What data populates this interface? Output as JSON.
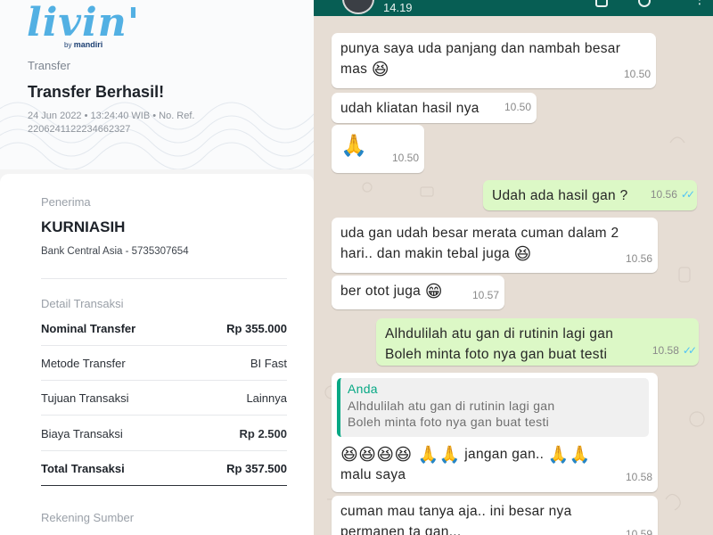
{
  "receipt": {
    "logo_text": "livin'",
    "logo_sub_prefix": "by",
    "logo_sub_brand": "mandiri",
    "breadcrumb": "Transfer",
    "title": "Transfer Berhasil!",
    "meta_line1": "24 Jun 2022 • 13:24:40 WIB • No. Ref.",
    "meta_line2": "2206241122234662327",
    "recipient_label": "Penerima",
    "recipient_name": "KURNIASIH",
    "recipient_bank": "Bank Central Asia - 5735307654",
    "detail_label": "Detail Transaksi",
    "rows": [
      {
        "label": "Nominal Transfer",
        "value": "Rp 355.000"
      },
      {
        "label": "Metode Transfer",
        "value": "BI Fast"
      },
      {
        "label": "Tujuan Transaksi",
        "value": "Lainnya"
      },
      {
        "label": "Biaya Transaksi",
        "value": "Rp 2.500"
      },
      {
        "label": "Total Transaksi",
        "value": "Rp 357.500"
      }
    ],
    "source_label": "Rekening Sumber"
  },
  "chat": {
    "header_time": "14.19",
    "messages": [
      {
        "dir": "in",
        "line1": "punya saya uda panjang dan nambah besar",
        "line2": "mas",
        "emoji": "😆",
        "time": "10.50"
      },
      {
        "dir": "in",
        "text": "udah kliatan hasil nya",
        "time": "10.50"
      },
      {
        "dir": "in",
        "emoji": "🙏",
        "time": "10.50"
      },
      {
        "dir": "out",
        "text": "Udah ada hasil gan ?",
        "time": "10.56",
        "ticks": "✓✓"
      },
      {
        "dir": "in",
        "line1": "uda gan udah besar merata cuman dalam 2",
        "line2": "hari.. dan makin tebal juga",
        "emoji": "😆",
        "time": "10.56"
      },
      {
        "dir": "in",
        "text": "ber otot juga",
        "emoji": "😁",
        "time": "10.57"
      },
      {
        "dir": "out",
        "line1": "Alhdulilah atu gan di rutinin lagi gan",
        "line2": "Boleh minta foto nya gan buat testi",
        "time": "10.58",
        "ticks": "✓✓"
      },
      {
        "dir": "in",
        "quote_author": "Anda",
        "quote_line1": "Alhdulilah atu gan di rutinin lagi gan",
        "quote_line2": "Boleh minta foto nya gan buat testi",
        "emojis": "😆😆😆😆 🙏🙏",
        "text_after": "jangan gan..",
        "emoji_end": "🙏🙏",
        "line2": "malu saya",
        "time": "10.58"
      },
      {
        "dir": "in",
        "line1": "cuman mau tanya aja.. ini besar nya",
        "line2": "permanen ta gan...",
        "time": "10.59"
      }
    ]
  }
}
